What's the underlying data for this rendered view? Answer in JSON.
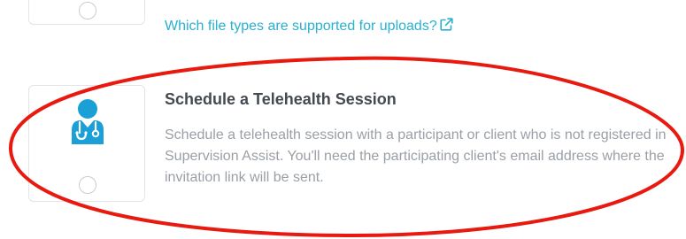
{
  "upload_option": {
    "help_link_text": "Which file types are supported for uploads?",
    "help_link_icon": "external-link-icon"
  },
  "telehealth_option": {
    "icon": "doctor-stethoscope-icon",
    "title": "Schedule a Telehealth Session",
    "description": "Schedule a telehealth session with a participant or client who is not registered in Supervision Assist. You'll need the participating client's email address where the invitation link will be sent.",
    "selected": false
  },
  "colors": {
    "link": "#2ab0d0",
    "icon": "#1aa0d6",
    "title": "#444a50",
    "description": "#9aa0a6",
    "annotation_ellipse": "#e8190f"
  }
}
